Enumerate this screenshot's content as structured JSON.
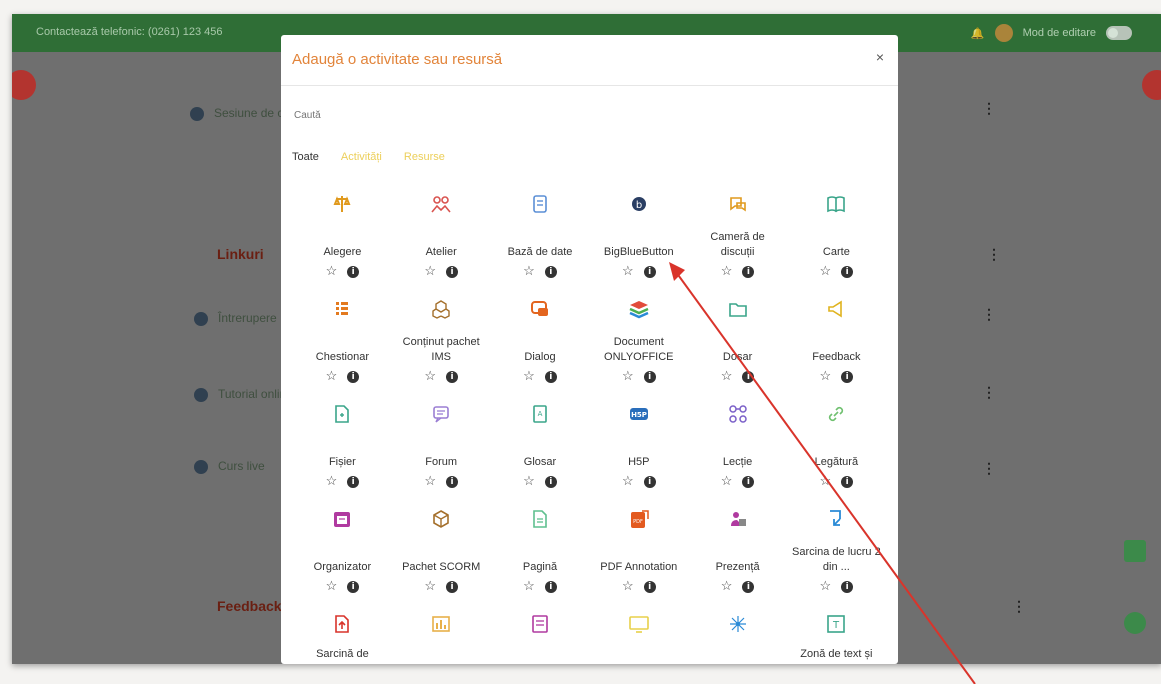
{
  "colors": {
    "accent": "#e2843a",
    "topbar": "#2f6e36",
    "arrow": "#d9342b"
  },
  "topbar": {
    "contact_text": "Contactează telefonic: (0261) 123 456",
    "user_text": "Mod de editare"
  },
  "background": {
    "row1": "Sesiune de curs",
    "section_linkuri": "Linkuri",
    "row2": "Întrerupere",
    "row3": "Tutorial online",
    "row4": "Curs live",
    "section_feedback": "Feedback"
  },
  "modal": {
    "title": "Adaugă o activitate sau resursă",
    "close": "×",
    "search_placeholder": "Caută",
    "tabs": [
      {
        "label": "Toate"
      },
      {
        "label": "Activități"
      },
      {
        "label": "Resurse"
      }
    ],
    "star": "☆",
    "info": "i",
    "items": [
      {
        "label": "Alegere",
        "icon": "choice-icon",
        "color": "#e09a1e"
      },
      {
        "label": "Atelier",
        "icon": "workshop-icon",
        "color": "#d9534f"
      },
      {
        "label": "Bază de date",
        "icon": "database-icon",
        "color": "#5b8fd6"
      },
      {
        "label": "BigBlueButton",
        "icon": "bigbluebutton-icon",
        "color": "#2a3e63"
      },
      {
        "label": "Cameră de discuții",
        "icon": "chat-icon",
        "color": "#e09a1e"
      },
      {
        "label": "Carte",
        "icon": "book-icon",
        "color": "#3aa58a"
      },
      {
        "label": "Chestionar",
        "icon": "quiz-icon",
        "color": "#e37a1f"
      },
      {
        "label": "Conținut pachet IMS",
        "icon": "ims-package-icon",
        "color": "#a46f2b"
      },
      {
        "label": "Dialog",
        "icon": "dialogue-icon",
        "color": "#e3651f"
      },
      {
        "label": "Document ONLYOFFICE",
        "icon": "onlyoffice-icon",
        "color": "#3b8f3b"
      },
      {
        "label": "Dosar",
        "icon": "folder-icon",
        "color": "#3aa58a"
      },
      {
        "label": "Feedback",
        "icon": "feedback-icon",
        "color": "#e0b31e"
      },
      {
        "label": "Fișier",
        "icon": "file-icon",
        "color": "#3aa58a"
      },
      {
        "label": "Forum",
        "icon": "forum-icon",
        "color": "#9b7fd4"
      },
      {
        "label": "Glosar",
        "icon": "glossary-icon",
        "color": "#3aa58a"
      },
      {
        "label": "H5P",
        "icon": "h5p-icon",
        "color": "#2a6ebb"
      },
      {
        "label": "Lecție",
        "icon": "lesson-icon",
        "color": "#7a5fc8"
      },
      {
        "label": "Legătură",
        "icon": "link-icon",
        "color": "#6fc06f"
      },
      {
        "label": "Organizator",
        "icon": "scheduler-icon",
        "color": "#b03aa0"
      },
      {
        "label": "Pachet SCORM",
        "icon": "scorm-icon",
        "color": "#a46f2b"
      },
      {
        "label": "Pagină",
        "icon": "page-icon",
        "color": "#5fc08f"
      },
      {
        "label": "PDF Annotation",
        "icon": "pdf-annotation-icon",
        "color": "#e35a1f"
      },
      {
        "label": "Prezență",
        "icon": "attendance-icon",
        "color": "#b03aa0"
      },
      {
        "label": "Sarcina de lucru 2 din ...",
        "icon": "assignment-icon",
        "color": "#2a8ad6"
      },
      {
        "label": "Sarcină de",
        "icon": "upload-assignment-icon",
        "color": "#d9342b"
      },
      {
        "label": "",
        "icon": "chart-icon",
        "color": "#e8b04a"
      },
      {
        "label": "",
        "icon": "survey-icon",
        "color": "#b03aa0"
      },
      {
        "label": "",
        "icon": "screen-icon",
        "color": "#e8d04a"
      },
      {
        "label": "",
        "icon": "network-icon",
        "color": "#2a8ad6"
      },
      {
        "label": "Zonă de text și",
        "icon": "text-area-icon",
        "color": "#3aa58a"
      }
    ]
  }
}
